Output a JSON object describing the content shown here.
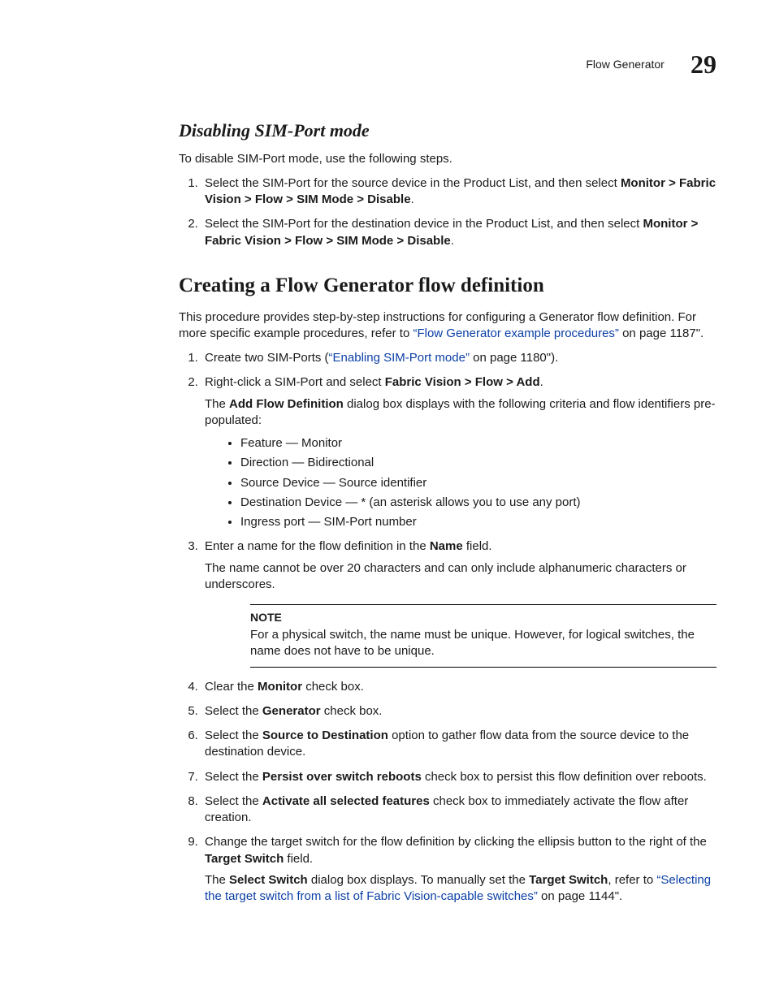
{
  "runhead": {
    "title": "Flow Generator",
    "chapnum": "29"
  },
  "sec1": {
    "title": "Disabling SIM-Port mode",
    "intro": "To disable SIM-Port mode, use the following steps.",
    "steps": [
      {
        "pre": "Select the SIM-Port for the source device in the Product List, and then select ",
        "bold": "Monitor > Fabric Vision > Flow > SIM Mode > Disable",
        "post": "."
      },
      {
        "pre": "Select the SIM-Port for the destination device in the Product List, and then select ",
        "bold": "Monitor > Fabric Vision > Flow > SIM Mode > Disable",
        "post": "."
      }
    ]
  },
  "sec2": {
    "title": "Creating a Flow Generator flow definition",
    "intro_pre": "This procedure provides step-by-step instructions for configuring a Generator flow definition. For more specific example procedures, refer to ",
    "intro_link": "“Flow Generator example procedures”",
    "intro_post": " on page 1187\".",
    "step1_pre": "Create two SIM-Ports (",
    "step1_link": "“Enabling SIM-Port mode”",
    "step1_post": " on page 1180\").",
    "step2_pre": "Right-click a SIM-Port and select ",
    "step2_bold": "Fabric Vision > Flow > Add",
    "step2_post": ".",
    "step2_body_pre": "The ",
    "step2_body_bold": "Add Flow Definition",
    "step2_body_post": " dialog box displays with the following criteria and flow identifiers pre-populated:",
    "bullets": [
      "Feature — Monitor",
      "Direction — Bidirectional",
      "Source Device — Source identifier",
      "Destination Device — * (an asterisk allows you to use any port)",
      "Ingress port — SIM-Port number"
    ],
    "step3_pre": "Enter a name for the flow definition in the ",
    "step3_bold": "Name",
    "step3_post": " field.",
    "step3_body": "The name cannot be over 20 characters and can only include alphanumeric characters or underscores.",
    "note_label": "NOTE",
    "note_body": "For a physical switch, the name must be unique. However, for logical switches, the name does not have to be unique.",
    "step4_pre": "Clear the ",
    "step4_bold": "Monitor",
    "step4_post": " check box.",
    "step5_pre": "Select the ",
    "step5_bold": "Generator",
    "step5_post": " check box.",
    "step6_pre": "Select the ",
    "step6_bold": "Source to Destination",
    "step6_post": " option to gather flow data from the source device to the destination device.",
    "step7_pre": "Select the ",
    "step7_bold": "Persist over switch reboots",
    "step7_post": " check box to persist this flow definition over reboots.",
    "step8_pre": "Select the ",
    "step8_bold": "Activate all selected features",
    "step8_post": " check box to immediately activate the flow after creation.",
    "step9_pre": "Change the target switch for the flow definition by clicking the ellipsis button to the right of the ",
    "step9_bold": "Target Switch",
    "step9_post": " field.",
    "step9_body_pre": "The ",
    "step9_body_bold1": "Select Switch",
    "step9_body_mid1": " dialog box displays. To manually set the ",
    "step9_body_bold2": "Target Switch",
    "step9_body_mid2": ", refer to ",
    "step9_body_link": "“Selecting the target switch from a list of Fabric Vision-capable switches”",
    "step9_body_post": " on page 1144\"."
  }
}
